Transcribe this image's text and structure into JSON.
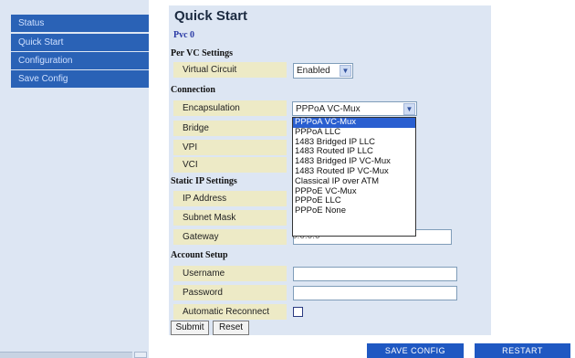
{
  "sidebar": {
    "items": [
      {
        "label": "Status"
      },
      {
        "label": "Quick Start"
      },
      {
        "label": "Configuration"
      },
      {
        "label": "Save Config"
      }
    ]
  },
  "page": {
    "title": "Quick Start",
    "pvc": "Pvc 0"
  },
  "per_vc": {
    "heading": "Per VC Settings",
    "virtual_circuit": {
      "label": "Virtual Circuit",
      "value": "Enabled"
    }
  },
  "connection": {
    "heading": "Connection",
    "encapsulation": {
      "label": "Encapsulation",
      "value": "PPPoA VC-Mux",
      "options": [
        "PPPoA VC-Mux",
        "PPPoA LLC",
        "1483 Bridged IP LLC",
        "1483 Routed IP LLC",
        "1483 Bridged IP VC-Mux",
        "1483 Routed IP VC-Mux",
        "Classical IP over ATM",
        "PPPoE VC-Mux",
        "PPPoE LLC",
        "PPPoE None"
      ]
    },
    "bridge_label": "Bridge",
    "vpi_label": "VPI",
    "vci_label": "VCI"
  },
  "static_ip": {
    "heading": "Static IP Settings",
    "ip_label": "IP Address",
    "subnet_label": "Subnet Mask",
    "gateway_label": "Gateway",
    "gateway_value": "0.0.0.0"
  },
  "account": {
    "heading": "Account Setup",
    "username_label": "Username",
    "password_label": "Password",
    "reconnect_label": "Automatic Reconnect"
  },
  "form": {
    "submit": "Submit",
    "reset": "Reset"
  },
  "footer": {
    "save_config": "SAVE CONFIG",
    "restart": "RESTART"
  }
}
